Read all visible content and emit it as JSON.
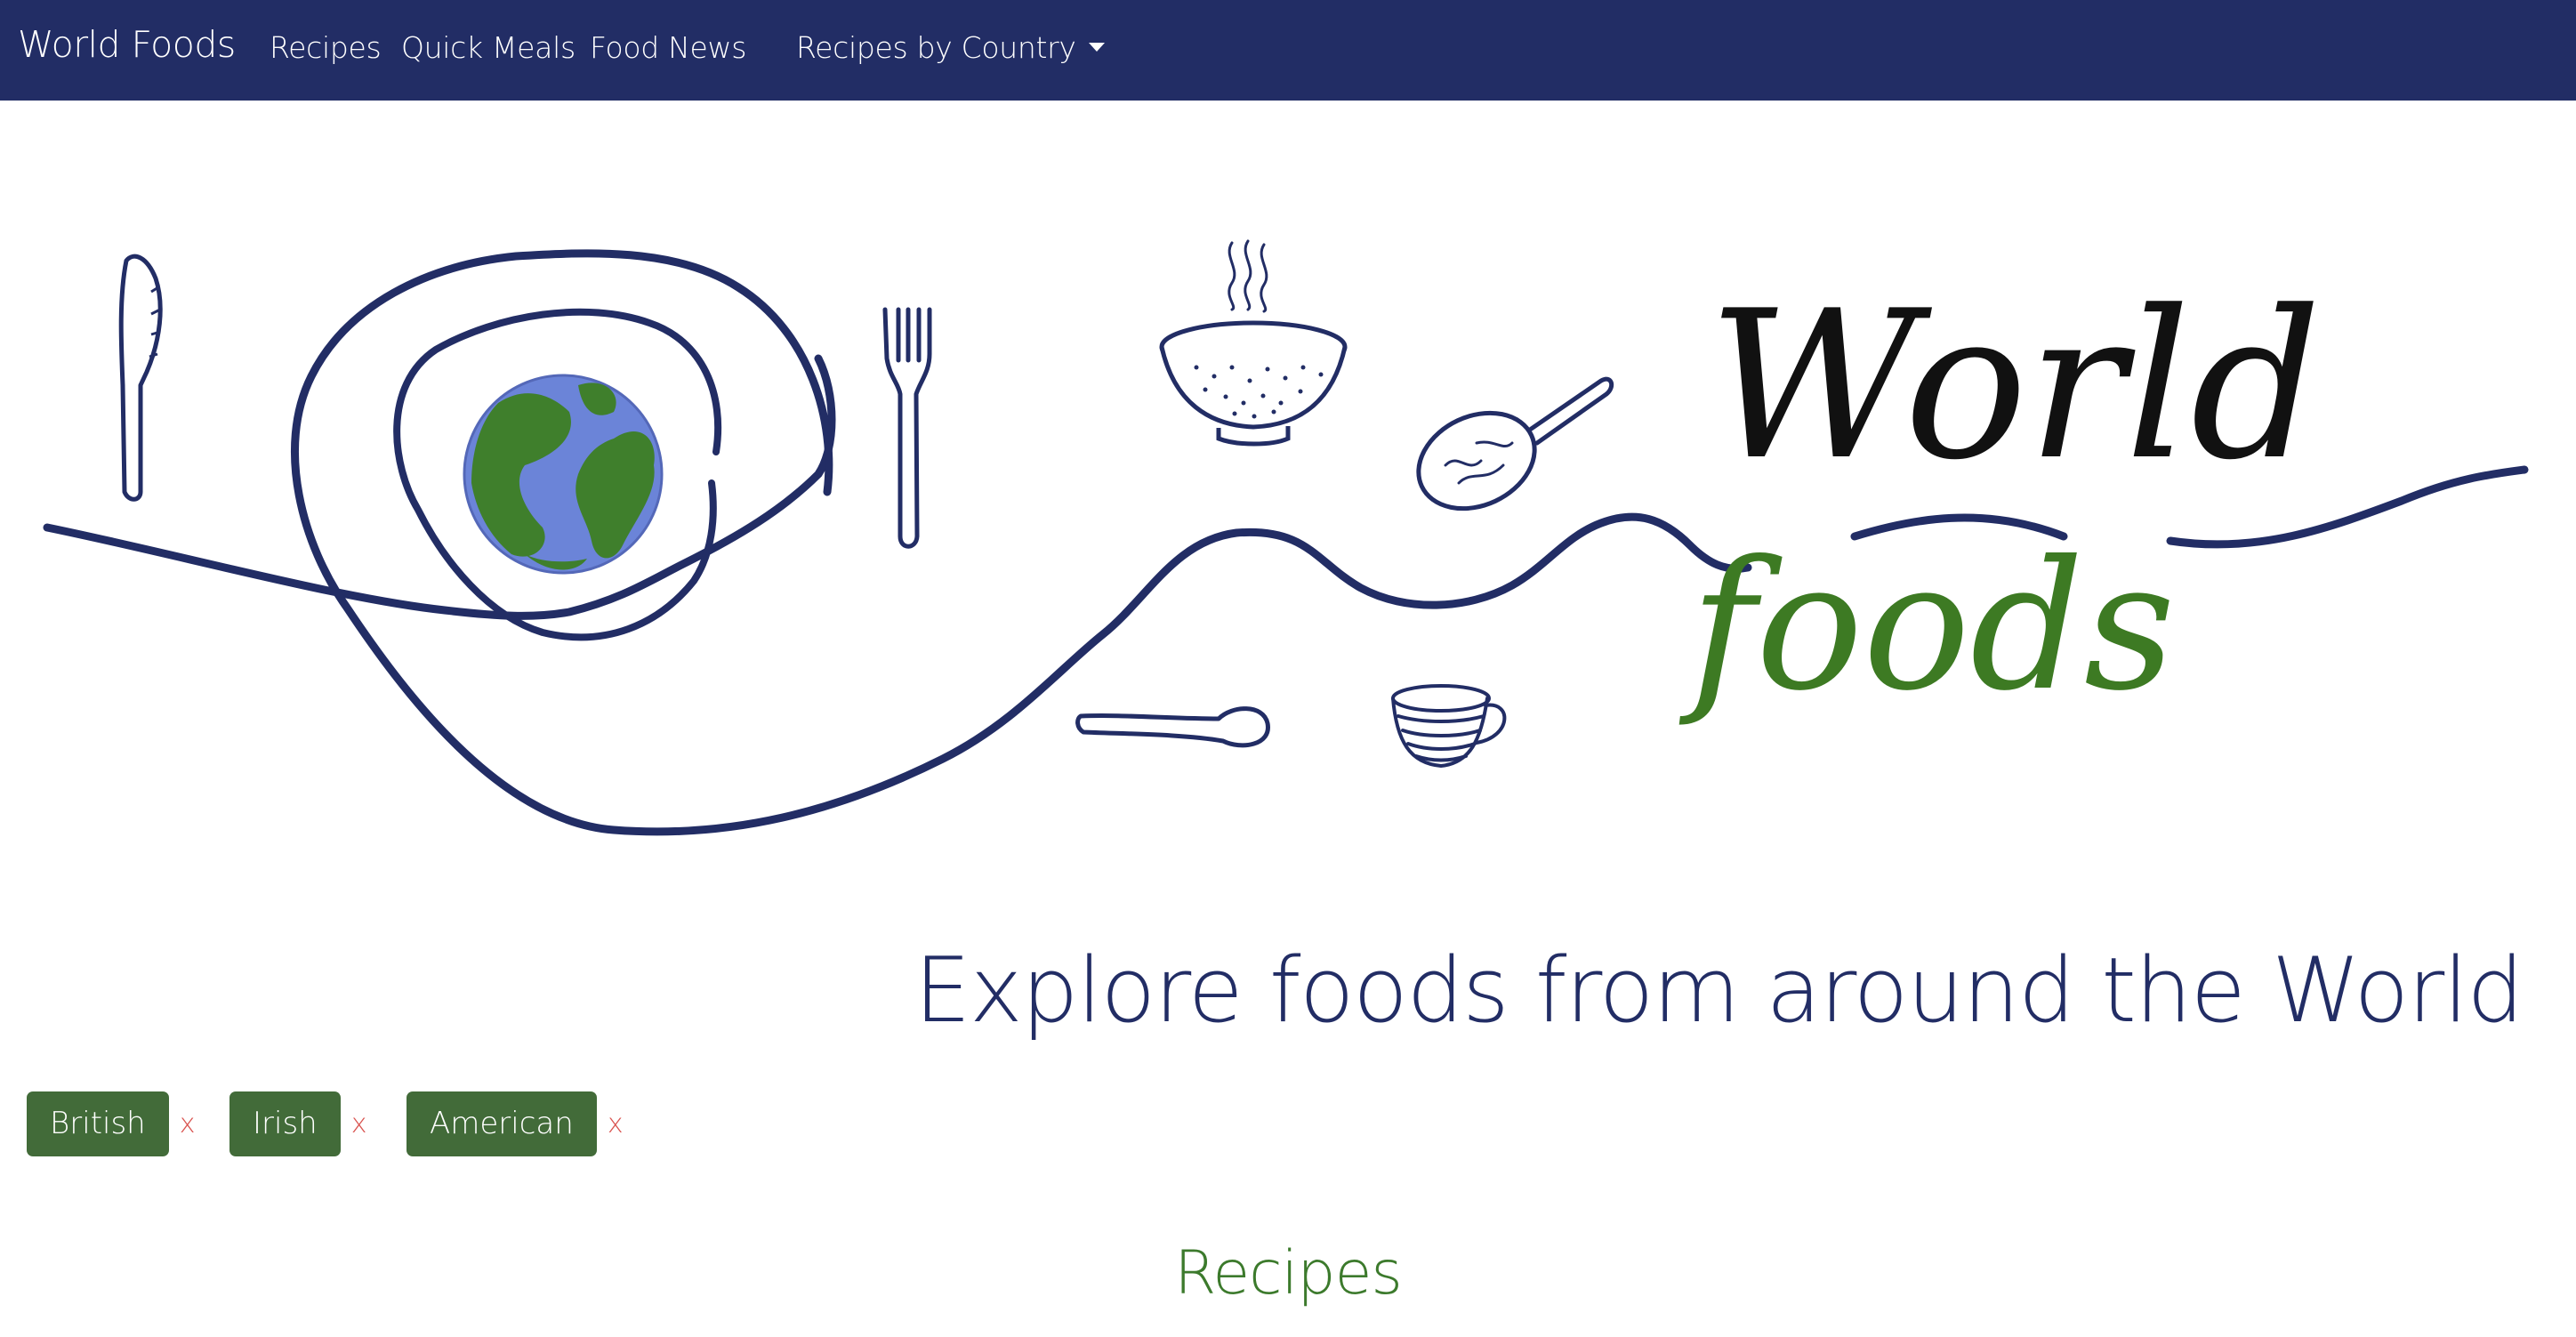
{
  "nav": {
    "brand": "World Foods",
    "links": [
      "Recipes",
      "Quick Meals",
      "Food News"
    ],
    "dropdown_label": "Recipes by Country"
  },
  "hero": {
    "logo_word_1": "World",
    "logo_word_2": "foods",
    "tagline": "Explore foods from around the World"
  },
  "filters": {
    "tags": [
      {
        "label": "British",
        "remove": "x"
      },
      {
        "label": "Irish",
        "remove": "x"
      },
      {
        "label": "American",
        "remove": "x"
      }
    ]
  },
  "section": {
    "title": "Recipes"
  },
  "colors": {
    "navy": "#222d65",
    "tag_green": "#426b39",
    "title_green": "#3c7a2c",
    "remove_red": "#d9534f",
    "logo_green": "#3d7a23"
  },
  "icons": [
    "knife-icon",
    "plate-icon",
    "globe-icon",
    "fork-icon",
    "bowl-icon",
    "steam-icon",
    "pan-icon",
    "spoon-icon",
    "cup-icon"
  ]
}
